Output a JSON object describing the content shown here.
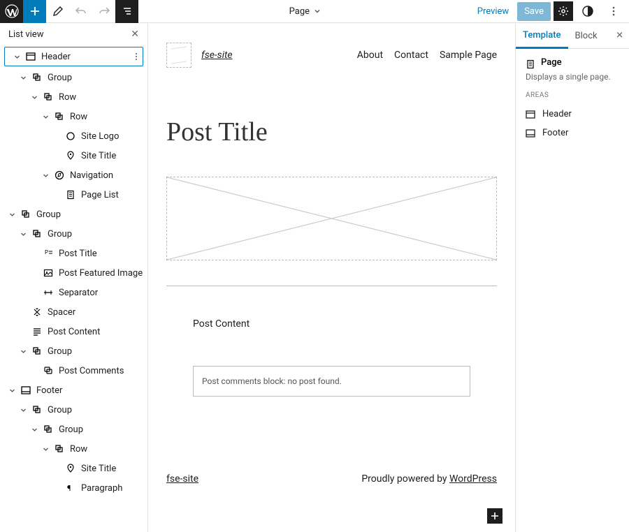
{
  "topbar": {
    "doc_label": "Page",
    "preview": "Preview",
    "save": "Save"
  },
  "listview": {
    "title": "List view",
    "items": [
      {
        "d": 0,
        "t": 1,
        "ico": "header",
        "lbl": "Header",
        "sel": true,
        "more": true
      },
      {
        "d": 1,
        "t": 1,
        "ico": "group",
        "lbl": "Group"
      },
      {
        "d": 2,
        "t": 1,
        "ico": "group",
        "lbl": "Row"
      },
      {
        "d": 3,
        "t": 1,
        "ico": "group",
        "lbl": "Row"
      },
      {
        "d": 4,
        "t": 0,
        "ico": "circle",
        "lbl": "Site Logo"
      },
      {
        "d": 4,
        "t": 0,
        "ico": "pin",
        "lbl": "Site Title"
      },
      {
        "d": 3,
        "t": 1,
        "ico": "nav",
        "lbl": "Navigation"
      },
      {
        "d": 4,
        "t": 0,
        "ico": "page",
        "lbl": "Page List"
      },
      {
        "d": 0,
        "t": 1,
        "ico": "group",
        "lbl": "Group"
      },
      {
        "d": 1,
        "t": 1,
        "ico": "group",
        "lbl": "Group"
      },
      {
        "d": 2,
        "t": 0,
        "ico": "posttitle",
        "lbl": "Post Title"
      },
      {
        "d": 2,
        "t": 0,
        "ico": "image",
        "lbl": "Post Featured Image"
      },
      {
        "d": 2,
        "t": 0,
        "ico": "sep",
        "lbl": "Separator"
      },
      {
        "d": 1,
        "t": 0,
        "ico": "spacer",
        "lbl": "Spacer"
      },
      {
        "d": 1,
        "t": 0,
        "ico": "content",
        "lbl": "Post Content"
      },
      {
        "d": 1,
        "t": 1,
        "ico": "group",
        "lbl": "Group"
      },
      {
        "d": 2,
        "t": 0,
        "ico": "comments",
        "lbl": "Post Comments"
      },
      {
        "d": 0,
        "t": 1,
        "ico": "footer",
        "lbl": "Footer"
      },
      {
        "d": 1,
        "t": 1,
        "ico": "group",
        "lbl": "Group"
      },
      {
        "d": 2,
        "t": 1,
        "ico": "group",
        "lbl": "Group"
      },
      {
        "d": 3,
        "t": 1,
        "ico": "group",
        "lbl": "Row"
      },
      {
        "d": 4,
        "t": 0,
        "ico": "pin",
        "lbl": "Site Title"
      },
      {
        "d": 4,
        "t": 0,
        "ico": "para",
        "lbl": "Paragraph"
      }
    ]
  },
  "canvas": {
    "site_title": "fse-site",
    "nav": [
      "About",
      "Contact",
      "Sample Page"
    ],
    "post_title": "Post Title",
    "post_content": "Post Content",
    "comments_msg": "Post comments block: no post found.",
    "footer_site": "fse-site",
    "footer_text": "Proudly powered by ",
    "footer_link": "WordPress"
  },
  "sidepanel": {
    "tabs": [
      "Template",
      "Block"
    ],
    "active_tab": 0,
    "page_label": "Page",
    "page_desc": "Displays a single page.",
    "areas_label": "AREAS",
    "areas": [
      {
        "ico": "header",
        "lbl": "Header"
      },
      {
        "ico": "footer",
        "lbl": "Footer"
      }
    ]
  }
}
